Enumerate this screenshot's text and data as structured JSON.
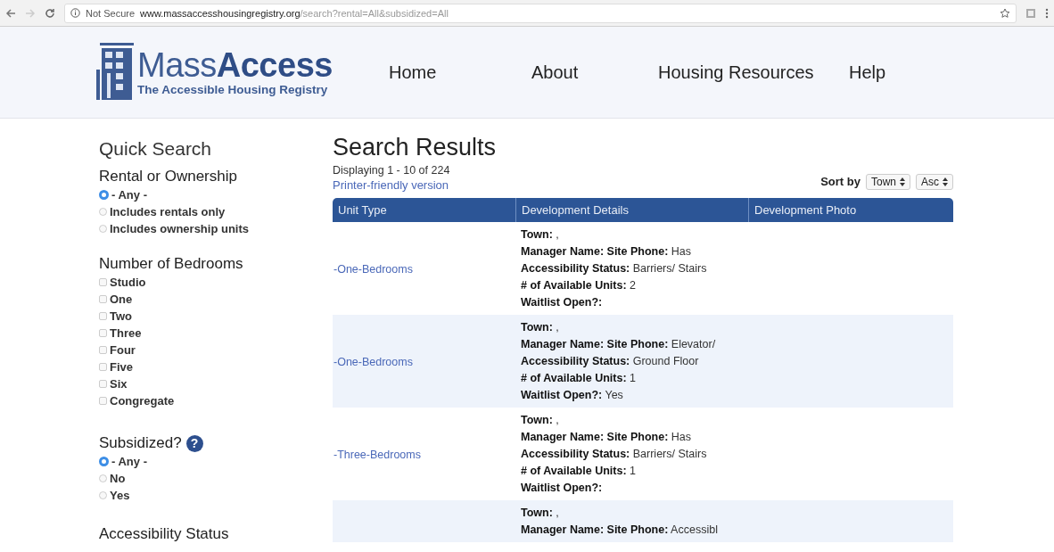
{
  "browser": {
    "security": "Not Secure",
    "url_domain": "www.massaccesshousingregistry.org",
    "url_path": "/search?rental=All&subsidized=All"
  },
  "header": {
    "logo_name_light": "Mass",
    "logo_name_bold": "Access",
    "logo_tagline": "The Accessible Housing Registry",
    "nav": [
      "Home",
      "About",
      "Housing Resources",
      "Help"
    ]
  },
  "sidebar": {
    "title": "Quick Search",
    "rental": {
      "heading": "Rental or Ownership",
      "options": [
        {
          "label": "- Any -",
          "selected": true
        },
        {
          "label": "Includes rentals only",
          "selected": false
        },
        {
          "label": "Includes ownership units",
          "selected": false
        }
      ]
    },
    "bedrooms": {
      "heading": "Number of Bedrooms",
      "options": [
        {
          "label": "Studio",
          "checked": false
        },
        {
          "label": "One",
          "checked": false
        },
        {
          "label": "Two",
          "checked": false
        },
        {
          "label": "Three",
          "checked": false
        },
        {
          "label": "Four",
          "checked": false
        },
        {
          "label": "Five",
          "checked": false
        },
        {
          "label": "Six",
          "checked": false
        },
        {
          "label": "Congregate",
          "checked": false
        }
      ]
    },
    "subsidized": {
      "heading": "Subsidized?",
      "help": "?",
      "options": [
        {
          "label": "- Any -",
          "selected": true
        },
        {
          "label": "No",
          "selected": false
        },
        {
          "label": "Yes",
          "selected": false
        }
      ]
    },
    "accessibility": {
      "heading": "Accessibility Status"
    }
  },
  "results": {
    "title": "Search Results",
    "count": "Displaying 1 - 10 of 224",
    "printer_link": "Printer-friendly version",
    "sort_label": "Sort by",
    "sort_field": "Town",
    "sort_order": "Asc",
    "table": {
      "columns": [
        "Unit Type",
        "Development Details",
        "Development Photo"
      ],
      "rows": [
        {
          "unit_type": "-One-Bedrooms",
          "details": [
            "**Town:** ,",
            "**Manager Name: Site Phone:** Has",
            "**Accessibility Status:** Barriers/ Stairs",
            "**# of Available Units:** 2",
            "**Waitlist Open?:**"
          ]
        },
        {
          "unit_type": "-One-Bedrooms",
          "details": [
            "**Town:** ,",
            "**Manager Name: Site Phone:** Elevator/",
            "**Accessibility Status:** Ground Floor",
            "**# of Available Units:** 1",
            "**Waitlist Open?:** Yes"
          ]
        },
        {
          "unit_type": "-Three-Bedrooms",
          "details": [
            "**Town:** ,",
            "**Manager Name: Site Phone:** Has",
            "**Accessibility Status:** Barriers/ Stairs",
            "**# of Available Units:** 1",
            "**Waitlist Open?:**"
          ]
        },
        {
          "unit_type": "",
          "details": [
            "**Town:** ,",
            "**Manager Name: Site Phone:** Accessibl"
          ]
        }
      ]
    }
  }
}
